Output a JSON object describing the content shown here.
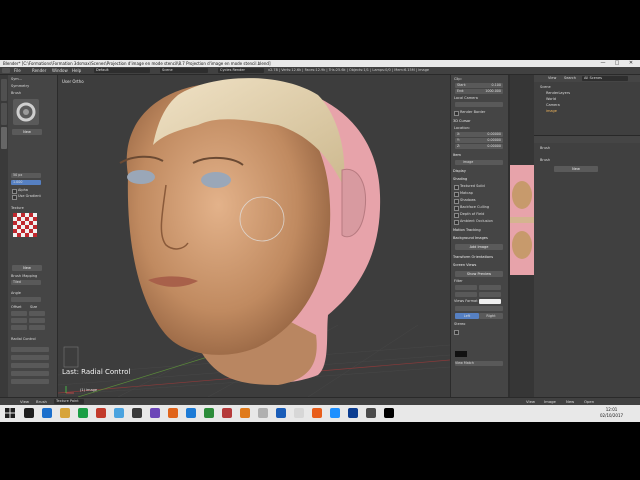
{
  "window": {
    "title": "Blender* [C:\\Formations\\Formation 3dsmax\\Scenes\\Projection d'image en mode stencil\\8.7 Projection d'image en mode stencil.blend]",
    "controls": [
      "—",
      "□",
      "✕"
    ]
  },
  "infobar": {
    "menus": [
      "File",
      "Render",
      "Window",
      "Help"
    ],
    "layout": "Default",
    "scene": "Scene",
    "engine": "Cycles Render",
    "stats": "v2.78 | Verts:12.6k | Faces:12.9k | Tris:25.6k | Objects:1/1 | Lamps:0/0 | Mem:6.15M | image"
  },
  "toolshelf": {
    "sections": [
      "Brush",
      "Texture",
      "Radial Control"
    ],
    "items": [
      "Sym...",
      "Symmetry",
      "Brush",
      "Radius",
      "Strength",
      "Alpha",
      "Use Gradient",
      "Brush Mapping",
      "Tiled",
      "Angle",
      "Offset",
      "Size"
    ],
    "radius_value": "50 px",
    "strength_value": "1.000",
    "mapping": "Tiled",
    "new_label": "New"
  },
  "viewport": {
    "title": "User Ortho",
    "last_operator": "Last: Radial Control",
    "object_label": "(1) image"
  },
  "npanel": {
    "rows": [
      "Clip:",
      "Start:",
      "End:",
      "Local Camera",
      "Render Border",
      "3D Cursor",
      "Location:",
      "X:",
      "Y:",
      "Z:",
      "Item",
      "image",
      "Display",
      "Shading",
      "Textured Solid",
      "Matcap",
      "Shadows",
      "Backface Culling",
      "Depth of Field",
      "Ambient Occlusion",
      "Motion Tracking",
      "Background Images",
      "Add Image",
      "Transform Orientations",
      "Screen Views",
      "Show Preview",
      "Filter",
      "Views Format",
      "Left",
      "Right",
      "Stereo",
      "View Match"
    ],
    "clip_start": "0.100",
    "clip_end": "1000.000",
    "loc_x": "0.00000",
    "loc_y": "0.00000",
    "loc_z": "0.00000",
    "item_name": "image",
    "add_image": "Add Image",
    "show_preview": "Show Preview"
  },
  "outliner": {
    "header": [
      "View",
      "Search",
      "All Scenes"
    ],
    "items": [
      "Scene",
      "RenderLayers",
      "World",
      "Camera",
      "image"
    ]
  },
  "props": {
    "rows": [
      "Brush",
      "New"
    ],
    "brush_label": "Brush",
    "new_label": "New"
  },
  "bottombar": {
    "items": [
      "View",
      "Brush",
      "Texture Paint"
    ],
    "right_items": [
      "View",
      "Image",
      "New",
      "Open"
    ]
  },
  "taskbar": {
    "time": "12:01",
    "date": "02/10/2017",
    "app_colors": [
      "#1e1e1e",
      "#1b6fcc",
      "#d7a43a",
      "#1b9e45",
      "#c23a2b",
      "#4aa3df",
      "#3a3a3a",
      "#6c46b8",
      "#e0641b",
      "#1d7bd6",
      "#2c8c3a",
      "#b53a3a",
      "#e07a1b",
      "#b0b0b0",
      "#1a5db8",
      "#d7d7d7",
      "#e85e1b",
      "#1e90ff",
      "#0b3d91",
      "#4a4a4a",
      "#000000"
    ]
  },
  "colors": {
    "accent": "#5680c2",
    "skin": "#c8946b",
    "stencil_pink": "#e7a3aa"
  }
}
